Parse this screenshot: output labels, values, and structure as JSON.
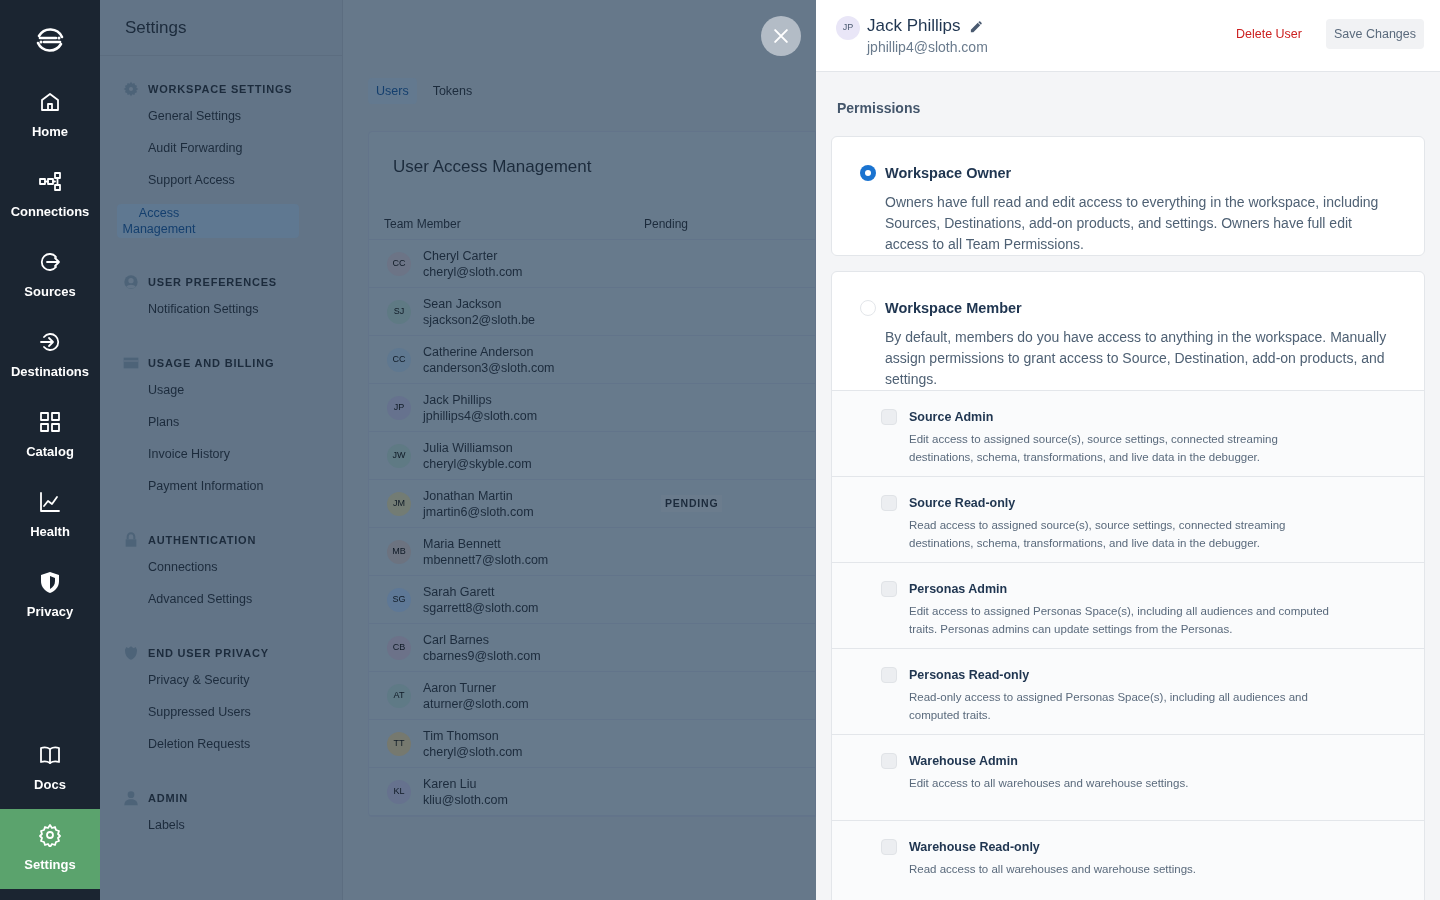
{
  "nav": {
    "items": [
      {
        "label": "Home",
        "kind": "home",
        "selected": false
      },
      {
        "label": "Connections",
        "kind": "connections",
        "selected": false
      },
      {
        "label": "Sources",
        "kind": "sources",
        "selected": false
      },
      {
        "label": "Destinations",
        "kind": "destinations",
        "selected": false
      },
      {
        "label": "Catalog",
        "kind": "catalog",
        "selected": false
      },
      {
        "label": "Health",
        "kind": "health",
        "selected": false
      },
      {
        "label": "Privacy",
        "kind": "privacy",
        "selected": false
      }
    ],
    "bottom_items": [
      {
        "label": "Docs",
        "kind": "docs",
        "selected": false
      },
      {
        "label": "Settings",
        "kind": "settings",
        "selected": true
      }
    ]
  },
  "settings": {
    "title": "Settings",
    "sections": [
      {
        "title": "WORKSPACE SETTINGS",
        "kind": "gear",
        "items": [
          {
            "label": "General Settings",
            "selected": false
          },
          {
            "label": "Audit Forwarding",
            "selected": false
          },
          {
            "label": "Support Access",
            "selected": false
          },
          {
            "label": "Access Management",
            "selected": true
          }
        ]
      },
      {
        "title": "USER PREFERENCES",
        "kind": "user",
        "items": [
          {
            "label": "Notification Settings",
            "selected": false
          }
        ]
      },
      {
        "title": "USAGE AND BILLING",
        "kind": "card",
        "items": [
          {
            "label": "Usage",
            "selected": false
          },
          {
            "label": "Plans",
            "selected": false
          },
          {
            "label": "Invoice History",
            "selected": false
          },
          {
            "label": "Payment Information",
            "selected": false
          }
        ]
      },
      {
        "title": "AUTHENTICATION",
        "kind": "lock",
        "items": [
          {
            "label": "Connections",
            "selected": false
          },
          {
            "label": "Advanced Settings",
            "selected": false
          }
        ]
      },
      {
        "title": "END USER PRIVACY",
        "kind": "shield",
        "items": [
          {
            "label": "Privacy & Security",
            "selected": false
          },
          {
            "label": "Suppressed Users",
            "selected": false
          },
          {
            "label": "Deletion Requests",
            "selected": false
          }
        ]
      },
      {
        "title": "ADMIN",
        "kind": "person",
        "items": [
          {
            "label": "Labels",
            "selected": false
          }
        ]
      }
    ]
  },
  "tabs": [
    {
      "label": "Users",
      "selected": true
    },
    {
      "label": "Tokens",
      "selected": false
    }
  ],
  "table": {
    "title": "User Access Management",
    "columns": [
      "Team Member",
      "Pending"
    ],
    "rows": [
      {
        "initials": "CC",
        "name": "Cheryl Carter",
        "email": "cheryl@sloth.com",
        "color": "#6c7486"
      },
      {
        "initials": "SJ",
        "name": "Sean Jackson",
        "email": "sjackson2@sloth.be",
        "color": "#5f7a84"
      },
      {
        "initials": "CC",
        "name": "Catherine Anderson",
        "email": "canderson3@sloth.com",
        "color": "#5f7890"
      },
      {
        "initials": "JP",
        "name": "Jack Phillips",
        "email": "jphillips4@sloth.com",
        "color": "#66728e"
      },
      {
        "initials": "JW",
        "name": "Julia Williamson",
        "email": "cheryl@skyble.com",
        "color": "#5f7a84"
      },
      {
        "initials": "JM",
        "name": "Jonathan Martin",
        "email": "jmartin6@sloth.com",
        "color": "#737c74",
        "badge": "PENDING"
      },
      {
        "initials": "MB",
        "name": "Maria Bennett",
        "email": "mbennett7@sloth.com",
        "color": "#6c7380"
      },
      {
        "initials": "SG",
        "name": "Sarah Garett",
        "email": "sgarrett8@sloth.com",
        "color": "#5e7896"
      },
      {
        "initials": "CB",
        "name": "Carl Barnes",
        "email": "cbarnes9@sloth.com",
        "color": "#6c7289"
      },
      {
        "initials": "AT",
        "name": "Aaron Turner",
        "email": "aturner@sloth.com",
        "color": "#5f7a86"
      },
      {
        "initials": "TT",
        "name": "Tim Thomson",
        "email": "cheryl@sloth.com",
        "color": "#76796f"
      },
      {
        "initials": "KL",
        "name": "Karen Liu",
        "email": "kliu@sloth.com",
        "color": "#66728e"
      }
    ]
  },
  "drawer": {
    "user": {
      "initials": "JP",
      "name": "Jack Phillips",
      "email": "jphillip4@sloth.com"
    },
    "delete_button": "Delete User",
    "save_button": "Save Changes",
    "permissions_title": "Permissions",
    "roles": [
      {
        "title": "Workspace Owner",
        "description": "Owners have full read and edit access to everything in the workspace, including Sources, Destinations, add-on products, and settings. Owners have full edit access to all Team Permissions.",
        "selected": true
      },
      {
        "title": "Workspace Member",
        "description": "By default, members do you have access to anything in the workspace. Manually assign permissions to grant access to Source, Destination, add-on products, and settings.",
        "selected": false,
        "permissions": [
          {
            "title": "Source Admin",
            "description": "Edit access to assigned source(s), source settings, connected streaming destinations, schema, transformations, and live data in the debugger.",
            "checked": false
          },
          {
            "title": "Source Read-only",
            "description": "Read access to assigned source(s), source settings, connected streaming destinations, schema, transformations, and live data in the debugger.",
            "checked": false
          },
          {
            "title": "Personas Admin",
            "description": "Edit access to assigned Personas Space(s), including all audiences and computed traits. Personas admins can update settings from the Personas.",
            "checked": false
          },
          {
            "title": "Personas Read-only",
            "description": "Read-only access to assigned Personas Space(s), including all audiences and computed traits.",
            "checked": false
          },
          {
            "title": "Warehouse Admin",
            "description": "Edit access to all warehouses and warehouse settings.",
            "checked": false
          },
          {
            "title": "Warehouse Read-only",
            "description": "Read access to all warehouses and warehouse settings.",
            "checked": false
          }
        ]
      }
    ]
  }
}
